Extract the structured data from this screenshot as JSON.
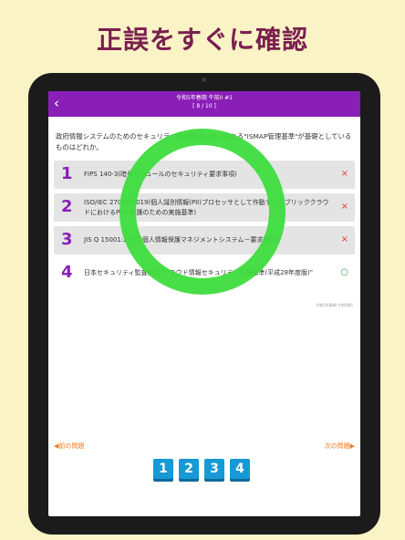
{
  "headline": "正誤をすぐに確認",
  "header": {
    "back_icon": "chevron-left-icon",
    "title": "令和5年春期 午前II #1",
    "progress": "[ 8 / 10 ]"
  },
  "question": "政府情報システムのためのセキュリティ評価制度に用いられる\"ISMAP管理基準\"が基礎としているものはどれか。",
  "options": [
    {
      "number": "1",
      "text": "FIPS 140-3(暗号モジュールのセキュリティ要求事項)",
      "mark": "×",
      "correct": false
    },
    {
      "number": "2",
      "text": "ISO/IEC 27018:2019(個人識別情報(PII)プロセッサとして作動するパブリッククラウドにおけるPIIの保護のための実施基準)",
      "mark": "×",
      "correct": false
    },
    {
      "number": "3",
      "text": "JIS Q 15001:2017(個人情報保護マネジメントシステム－要求事項)",
      "mark": "×",
      "correct": false
    },
    {
      "number": "4",
      "text": "日本セキュリティ監査協会\"クラウド情報セキュリティ管理基準(平成28年度版)\"",
      "mark": "○",
      "correct": true
    }
  ],
  "source": "令和5年春期 午前II問5",
  "nav": {
    "prev": "前の問題",
    "next": "次の問題"
  },
  "answer_buttons": [
    "1",
    "2",
    "3",
    "4"
  ],
  "colors": {
    "accent": "#8a1fb8",
    "headline": "#7a1f4f",
    "correct": "#2e9e44",
    "wrong": "#e53935",
    "nav": "#f07a1c",
    "button": "#1699d4",
    "overlay_ring": "#3ddc3d"
  }
}
